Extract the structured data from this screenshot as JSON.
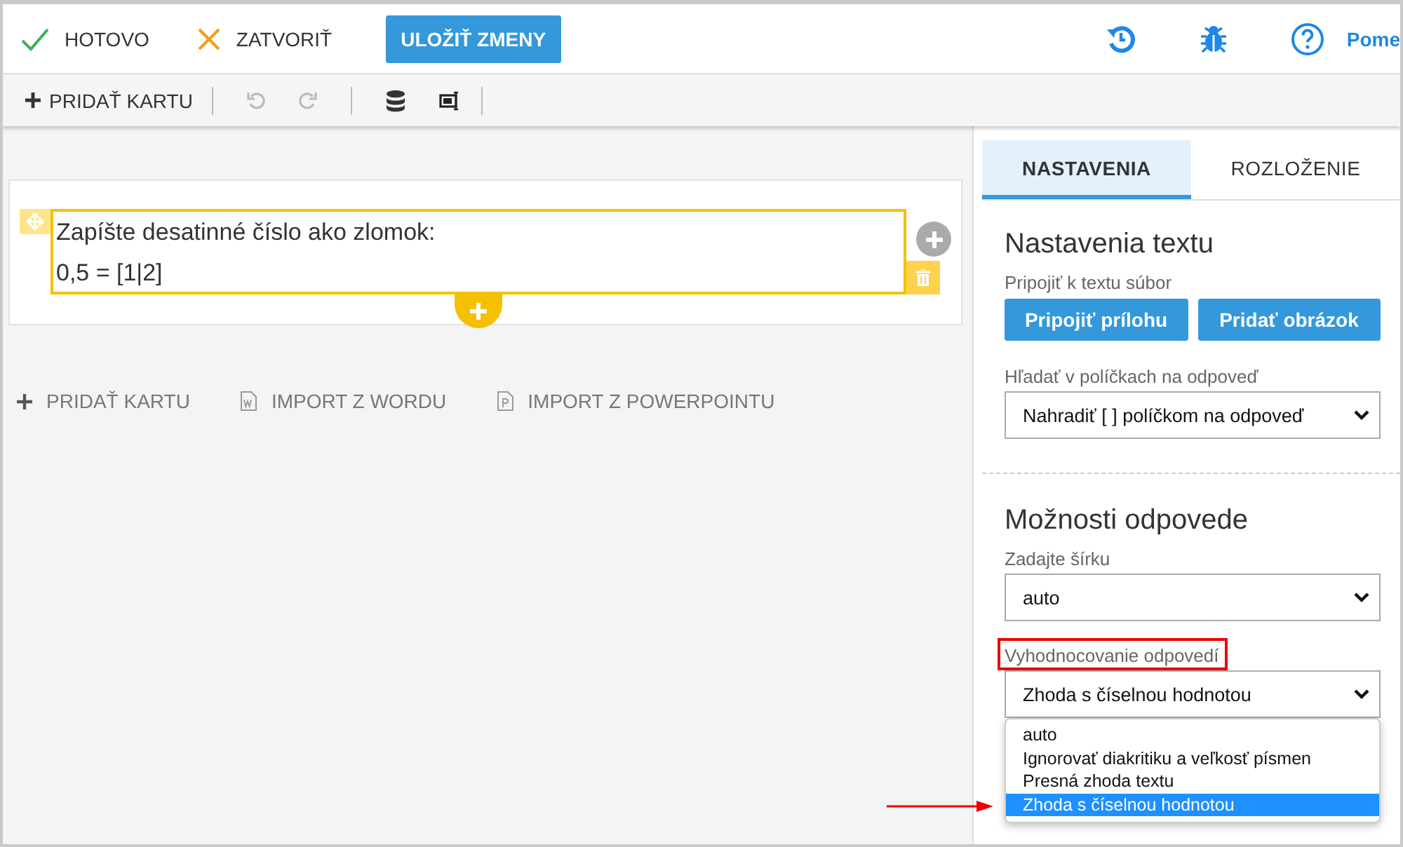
{
  "top_bar": {
    "actions": [
      {
        "kind": "done",
        "label": "HOTOVO"
      },
      {
        "kind": "close",
        "label": "ZATVORIŤ"
      },
      {
        "kind": "save",
        "label": "ULOŽIŤ ZMENY"
      }
    ],
    "help_label": "Pome"
  },
  "toolbar": {
    "add_card": "PRIDAŤ KARTU",
    "undo": {
      "disabled": true
    },
    "redo": {
      "disabled": true
    }
  },
  "card": {
    "lines": [
      "Zapíšte desatinné číslo ako zlomok:",
      "0,5 = [1|2]"
    ]
  },
  "bottom_links": [
    {
      "kind": "add",
      "label": "PRIDAŤ KARTU"
    },
    {
      "kind": "word",
      "label": "IMPORT Z WORDU"
    },
    {
      "kind": "powerpoint",
      "label": "IMPORT Z POWERPOINTU"
    }
  ],
  "panel": {
    "tabs": [
      {
        "label": "NASTAVENIA",
        "selected": true
      },
      {
        "label": "ROZLOŽENIE",
        "selected": false
      }
    ],
    "text_settings": {
      "title": "Nastavenia textu",
      "attach_label": "Pripojiť k textu súbor",
      "buttons": [
        "Pripojiť prílohu",
        "Pridať obrázok"
      ],
      "search_label": "Hľadať v políčkach na odpoveď",
      "search_value": "Nahradiť [ ] políčkom na odpoveď"
    },
    "answer_options": {
      "title": "Možnosti odpovede",
      "width_label": "Zadajte šírku",
      "width_value": "auto",
      "evaluation_label": "Vyhodnocovanie odpovedí",
      "evaluation_highlighted": true,
      "evaluation_value": "Zhoda s číselnou hodnotou",
      "evaluation_options": [
        {
          "label": "auto",
          "selected": false
        },
        {
          "label": "Ignorovať diakritiku a veľkosť písmen",
          "selected": false
        },
        {
          "label": "Presná zhoda textu",
          "selected": false
        },
        {
          "label": "Zhoda s číselnou hodnotou",
          "selected": true,
          "arrow": true
        }
      ]
    }
  }
}
